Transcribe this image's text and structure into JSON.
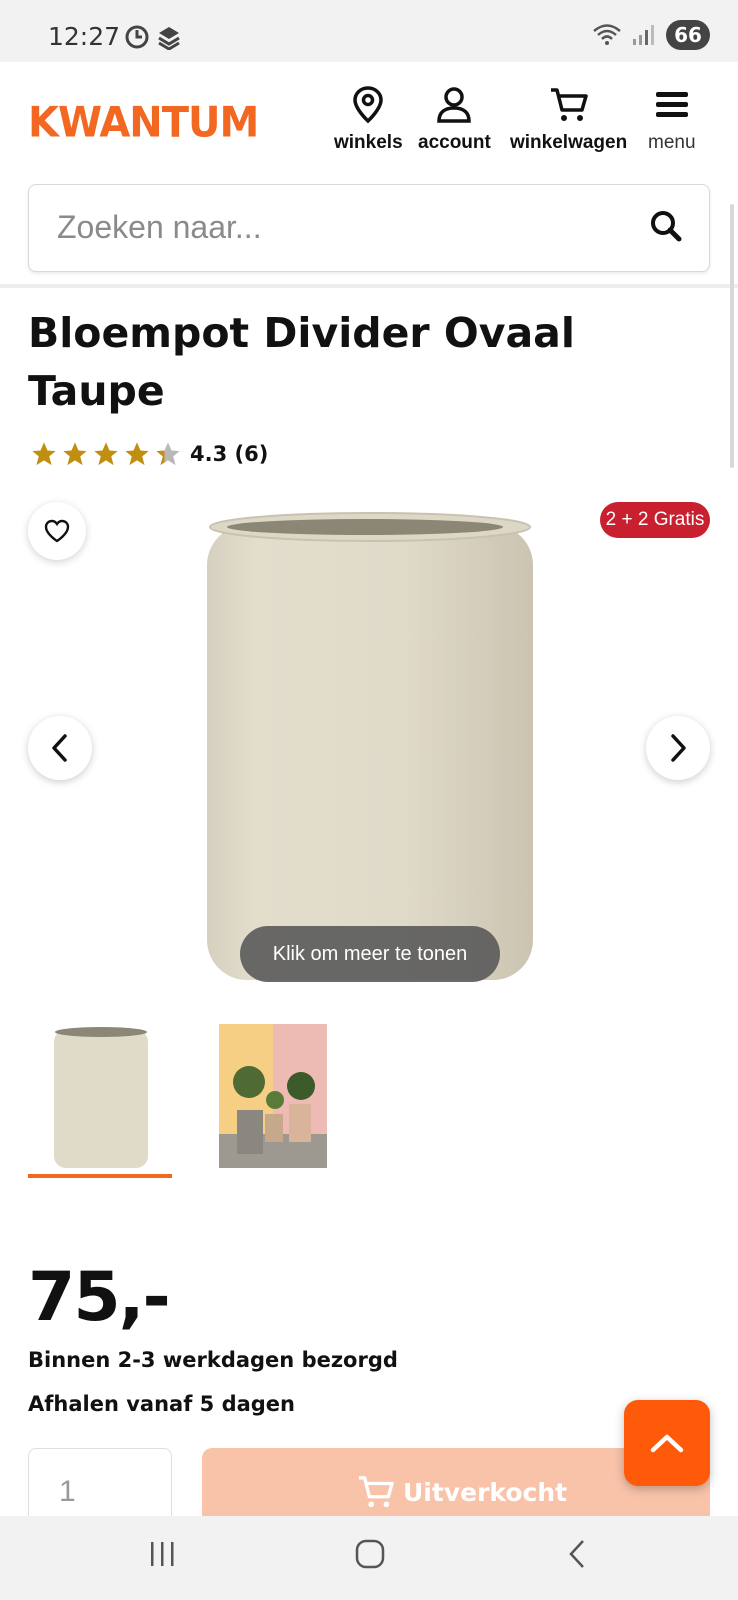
{
  "status_bar": {
    "time": "12:27",
    "battery": "66"
  },
  "header": {
    "logo": "KWANTUM",
    "nav": [
      {
        "label": "winkels",
        "icon": "location-pin-icon"
      },
      {
        "label": "account",
        "icon": "user-icon"
      },
      {
        "label": "winkelwagen",
        "icon": "cart-icon"
      },
      {
        "label": "menu",
        "icon": "hamburger-icon"
      }
    ]
  },
  "search": {
    "placeholder": "Zoeken naar..."
  },
  "product": {
    "title": "Bloempot Divider Ovaal Taupe",
    "rating_text": "4.3 (6)",
    "rating_value": 4.3,
    "rating_max": 5,
    "promo_badge": "2 + 2 Gratis",
    "show_more": "Klik om meer te tonen",
    "price": "75,-",
    "delivery": "Binnen 2-3 werkdagen bezorgd",
    "pickup": "Afhalen vanaf 5 dagen"
  },
  "purchase": {
    "quantity": "1",
    "button_label": "Uitverkocht"
  },
  "colors": {
    "brand_orange": "#f26722",
    "badge_red": "#c8202f",
    "star_gold": "#c18f0f",
    "sold_out_bg": "#f9c3aa",
    "scroll_top_bg": "#ff5a0a"
  }
}
